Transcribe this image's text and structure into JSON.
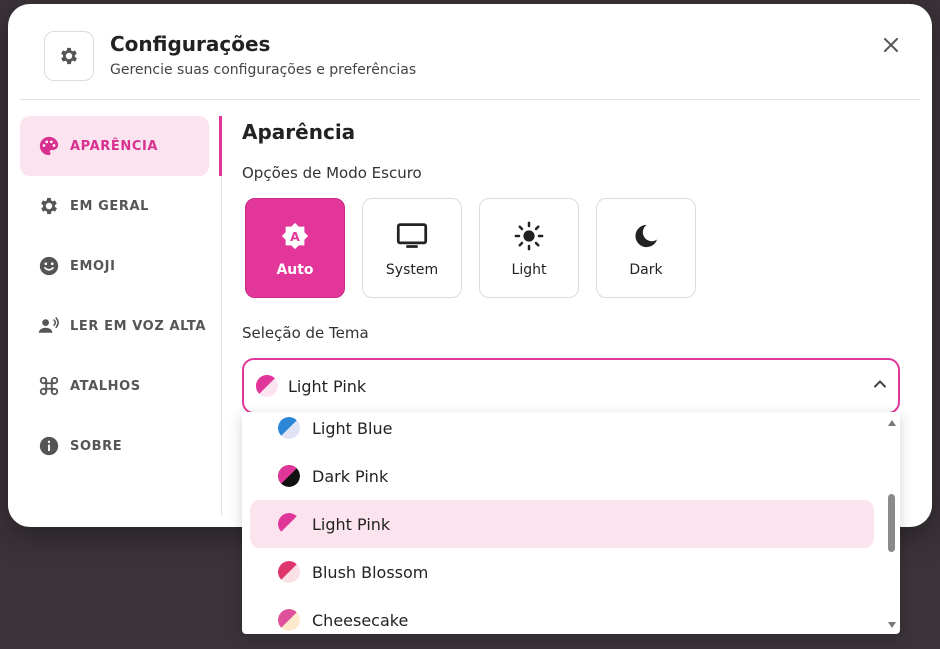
{
  "header": {
    "title": "Configurações",
    "subtitle": "Gerencie suas configurações e preferências",
    "icon": "gear-icon",
    "close_icon": "close-icon"
  },
  "sidebar": {
    "items": [
      {
        "label": "APARÊNCIA",
        "icon": "palette-icon",
        "active": true
      },
      {
        "label": "EM GERAL",
        "icon": "gear-icon",
        "active": false
      },
      {
        "label": "EMOJI",
        "icon": "smiley-icon",
        "active": false
      },
      {
        "label": "LER EM VOZ ALTA",
        "icon": "speaker-person-icon",
        "active": false
      },
      {
        "label": "ATALHOS",
        "icon": "command-icon",
        "active": false
      },
      {
        "label": "SOBRE",
        "icon": "info-icon",
        "active": false
      }
    ]
  },
  "main": {
    "section_title": "Aparência",
    "dark_mode_label": "Opções de Modo Escuro",
    "modes": [
      {
        "label": "Auto",
        "icon": "auto-brightness-icon",
        "selected": true
      },
      {
        "label": "System",
        "icon": "monitor-icon",
        "selected": false
      },
      {
        "label": "Light",
        "icon": "sun-icon",
        "selected": false
      },
      {
        "label": "Dark",
        "icon": "moon-icon",
        "selected": false
      }
    ],
    "theme_label": "Seleção de Tema",
    "theme_select": {
      "value": "Light Pink",
      "options": [
        {
          "label": "Light Blue",
          "colors": [
            "#2b86d6",
            "#dfe3f5"
          ]
        },
        {
          "label": "Dark Pink",
          "colors": [
            "#e0369a",
            "#111111"
          ]
        },
        {
          "label": "Light Pink",
          "colors": [
            "#e0369a",
            "#fde3ef"
          ],
          "selected": true
        },
        {
          "label": "Blush Blossom",
          "colors": [
            "#e0366e",
            "#fbe0e6"
          ]
        },
        {
          "label": "Cheesecake",
          "colors": [
            "#e0509a",
            "#fde9cc"
          ]
        }
      ]
    }
  },
  "colors": {
    "accent": "#e0369a",
    "accent_light": "#fbe3ef",
    "backdrop": "#3a3339"
  }
}
